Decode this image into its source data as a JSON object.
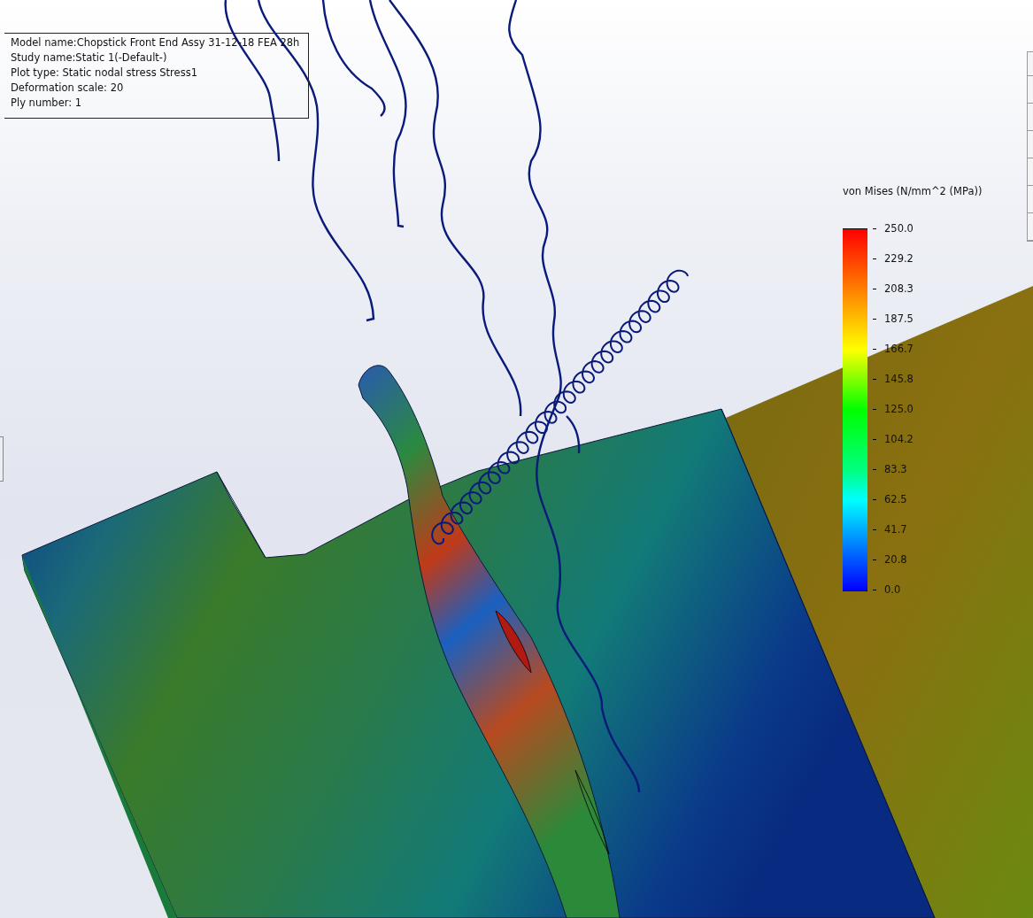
{
  "info_box": {
    "lines": [
      "Model name:Chopstick Front End Assy 31-12-18 FEA 28h",
      "Study name:Static 1(-Default-)",
      "Plot type: Static nodal stress Stress1",
      "Deformation scale: 20",
      "Ply number: 1"
    ]
  },
  "legend": {
    "title": "von Mises (N/mm^2 (MPa))",
    "ticks": [
      "250.0",
      "229.2",
      "208.3",
      "187.5",
      "166.7",
      "145.8",
      "125.0",
      "104.2",
      "83.3",
      "62.5",
      "41.7",
      "20.8",
      "0.0"
    ]
  }
}
